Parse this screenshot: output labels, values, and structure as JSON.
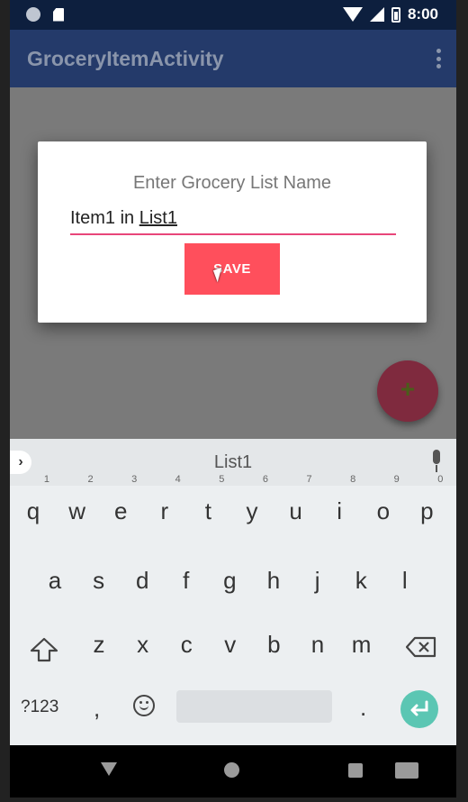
{
  "status_bar": {
    "time": "8:00"
  },
  "toolbar": {
    "title": "GroceryItemActivity"
  },
  "dialog": {
    "title": "Enter Grocery List Name",
    "input_value_plain": "Item1 in ",
    "input_value_underlined": "List1",
    "save_label": "SAVE"
  },
  "fab": {
    "label": "+"
  },
  "keyboard": {
    "suggestion": "List1",
    "row1": [
      {
        "k": "q",
        "n": "1"
      },
      {
        "k": "w",
        "n": "2"
      },
      {
        "k": "e",
        "n": "3"
      },
      {
        "k": "r",
        "n": "4"
      },
      {
        "k": "t",
        "n": "5"
      },
      {
        "k": "y",
        "n": "6"
      },
      {
        "k": "u",
        "n": "7"
      },
      {
        "k": "i",
        "n": "8"
      },
      {
        "k": "o",
        "n": "9"
      },
      {
        "k": "p",
        "n": "0"
      }
    ],
    "row2": [
      "a",
      "s",
      "d",
      "f",
      "g",
      "h",
      "j",
      "k",
      "l"
    ],
    "row3": [
      "z",
      "x",
      "c",
      "v",
      "b",
      "n",
      "m"
    ],
    "symbols_label": "?123",
    "comma": ",",
    "period": "."
  },
  "colors": {
    "appbar": "#243a6a",
    "accent": "#ff4f5c",
    "underline": "#e8467a",
    "enter_key": "#5bc6b3"
  }
}
